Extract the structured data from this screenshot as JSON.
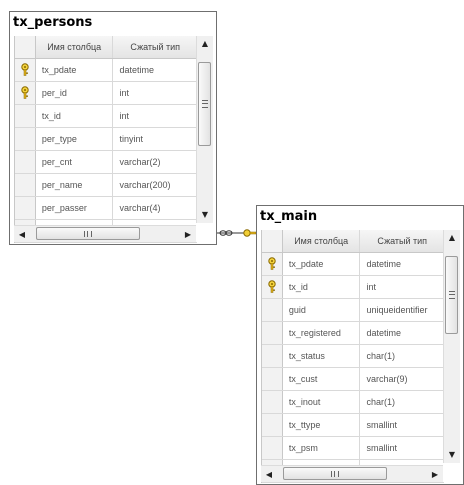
{
  "column_headers": {
    "name": "Имя столбца",
    "type": "Сжатый тип"
  },
  "tables": [
    {
      "title": "tx_persons",
      "rows": [
        {
          "key": true,
          "name": "tx_pdate",
          "type": "datetime"
        },
        {
          "key": true,
          "name": "per_id",
          "type": "int"
        },
        {
          "key": false,
          "name": "tx_id",
          "type": "int"
        },
        {
          "key": false,
          "name": "per_type",
          "type": "tinyint"
        },
        {
          "key": false,
          "name": "per_cnt",
          "type": "varchar(2)"
        },
        {
          "key": false,
          "name": "per_name",
          "type": "varchar(200)"
        },
        {
          "key": false,
          "name": "per_passer",
          "type": "varchar(4)"
        },
        {
          "key": false,
          "name": "",
          "type": ""
        }
      ]
    },
    {
      "title": "tx_main",
      "rows": [
        {
          "key": true,
          "name": "tx_pdate",
          "type": "datetime"
        },
        {
          "key": true,
          "name": "tx_id",
          "type": "int"
        },
        {
          "key": false,
          "name": "guid",
          "type": "uniqueidentifier"
        },
        {
          "key": false,
          "name": "tx_registered",
          "type": "datetime"
        },
        {
          "key": false,
          "name": "tx_status",
          "type": "char(1)"
        },
        {
          "key": false,
          "name": "tx_cust",
          "type": "varchar(9)"
        },
        {
          "key": false,
          "name": "tx_inout",
          "type": "char(1)"
        },
        {
          "key": false,
          "name": "tx_ttype",
          "type": "smallint"
        },
        {
          "key": false,
          "name": "tx_psm",
          "type": "smallint"
        },
        {
          "key": false,
          "name": "",
          "type": ""
        }
      ]
    }
  ],
  "icons": {
    "key": "primary-key-icon",
    "scroll_up": "scroll-up-arrow-icon",
    "scroll_down": "scroll-down-arrow-icon",
    "scroll_left": "scroll-left-arrow-icon",
    "scroll_right": "scroll-right-arrow-icon"
  },
  "colors": {
    "key_gold": "#e2b21a",
    "relation_line": "#333333"
  }
}
